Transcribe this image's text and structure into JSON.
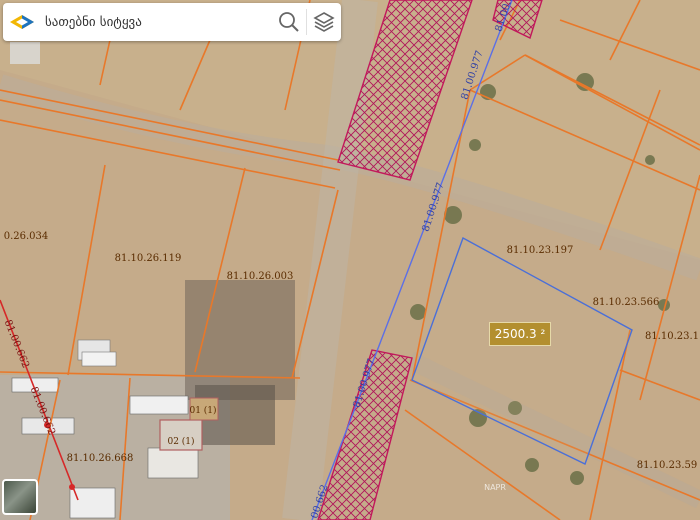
{
  "search": {
    "placeholder": "სათებნი სიტყვა"
  },
  "area": {
    "label": "2500.3 ² "
  },
  "parcels": [
    {
      "label": "0.26.034"
    },
    {
      "label": "81.10.26.119"
    },
    {
      "label": "81.10.26.003"
    },
    {
      "label": "81.10.23.197"
    },
    {
      "label": "81.10.23.566"
    },
    {
      "label": "81.10.23.1"
    },
    {
      "label": "81.10.26.668"
    },
    {
      "label": "81.10.23.59"
    }
  ],
  "roads": [
    {
      "label": "81.00.977"
    },
    {
      "label": "81.00.977"
    },
    {
      "label": "81.00.977"
    },
    {
      "label": "81.00.977"
    },
    {
      "label": "81.00.662"
    },
    {
      "label": "81.00.662"
    }
  ],
  "buildings": [
    {
      "label": "01 (1)"
    },
    {
      "label": "02 (1)"
    }
  ],
  "watermark": {
    "label": "NAPR"
  },
  "colors": {
    "parcel_border": "#e8782a",
    "road_highlight": "#c2185b",
    "selected_parcel": "#4a6fd8",
    "pipeline": "#d62828",
    "area_badge": "#b38f2f"
  },
  "icons": {
    "search": "search-icon",
    "layers": "layers-icon",
    "logo": "napr-logo-icon"
  }
}
